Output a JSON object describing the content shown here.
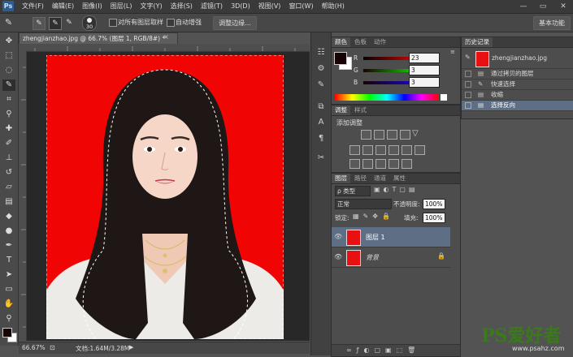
{
  "menubar": {
    "logo": "Ps",
    "items": [
      "文件(F)",
      "编辑(E)",
      "图像(I)",
      "图层(L)",
      "文字(Y)",
      "选择(S)",
      "滤镜(T)",
      "3D(D)",
      "视图(V)",
      "窗口(W)",
      "帮助(H)"
    ],
    "minimize": "—",
    "restore": "▭",
    "close": "✕"
  },
  "options": {
    "brush_size": "30",
    "sample_all_layers": "对所有图层取样",
    "auto_enhance": "自动增强",
    "refine_edge": "调整边缘...",
    "workspace": "基本功能"
  },
  "document": {
    "tab_title": "zhengjianzhao.jpg @ 66.7% (图层 1, RGB/8#) *",
    "close": "×"
  },
  "status": {
    "zoom": "66.67%",
    "doc_info": "文档:1.64M/3.28M"
  },
  "color_panel": {
    "tabs": [
      "颜色",
      "色板",
      "动作"
    ],
    "r_label": "R",
    "g_label": "G",
    "b_label": "B",
    "r_value": "23",
    "g_value": "3",
    "b_value": "3",
    "foreground_color": "#170303",
    "background_color": "#ffffff"
  },
  "adjust_panel": {
    "tabs": [
      "调整",
      "样式"
    ],
    "title": "添加调整"
  },
  "layers_panel": {
    "tabs": [
      "图层",
      "路径",
      "通道",
      "属性"
    ],
    "filter_kind": "ρ 类型",
    "blend_mode": "正常",
    "opacity_label": "不透明度:",
    "opacity_value": "100%",
    "lock_label": "锁定:",
    "fill_label": "填充:",
    "fill_value": "100%",
    "layers": [
      {
        "name": "图层 1",
        "selected": true
      },
      {
        "name": "背景",
        "selected": false,
        "locked": true
      }
    ]
  },
  "history_panel": {
    "tab": "历史记录",
    "snapshot": "zhengjianzhao.jpg",
    "items": [
      "通过拷贝的图层",
      "快速选择",
      "收缩",
      "选择反向"
    ],
    "active_index": 3
  },
  "watermark": {
    "brand": "PS爱好者",
    "url": "www.psahz.com"
  }
}
